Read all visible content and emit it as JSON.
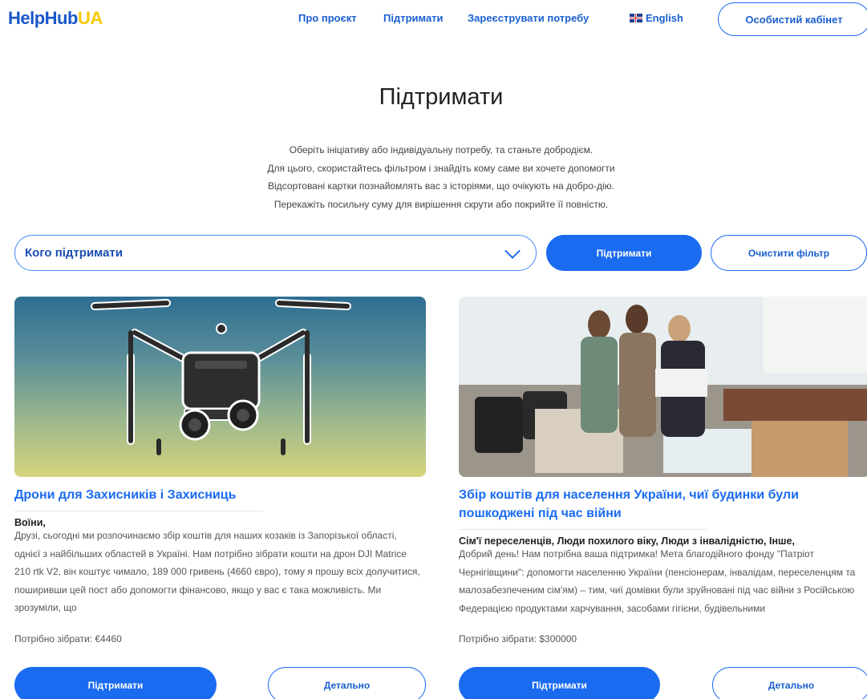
{
  "header": {
    "logo_part1": "HelpHub",
    "logo_part2": "UA",
    "nav": {
      "about": "Про проєкт",
      "support": "Підтримати",
      "register": "Зареєструвати потребу",
      "language": "English"
    },
    "cabinet_button": "Особистий кабінет"
  },
  "hero": {
    "title": "Підтримати",
    "intro_lines": [
      "Оберіть ініціативу або індивідуальну потребу, та станьте добродієм.",
      "Для цього, скористайтесь фільтром і знайдіть кому саме ви хочете допомогти",
      "Відсортовані картки познайомлять вас з історіями, що очікують на добро-дію.",
      "Перекажіть посильну суму для вирішення скрути або покрийте її повністю."
    ]
  },
  "filter": {
    "select_label": "Кого підтримати",
    "apply_button": "Підтримати",
    "clear_button": "Очистити фільтр"
  },
  "cards": [
    {
      "title": "Дрони для Захисників і Захисниць",
      "categories": "Воїни,",
      "description": "Друзі, сьогодні ми розпочинаємо збір коштів для наших козаків із Запорізької області, однієї з найбільших областей в Україні. Нам потрібно зібрати кошти на дрон DJI Matrice 210 rtk V2, він коштує чимало, 189 000 гривень (4660 євро), тому я прошу всіх долучитися, поширивши цей пост або допомогти фінансово, якщо у вас є така можливість. Ми зрозуміли, що",
      "goal": "Потрібно зібрати: €4460",
      "support_button": "Підтримати",
      "details_button": "Детально"
    },
    {
      "title": "Збір коштів для населення України, чиї будинки були пошкоджені під час війни",
      "categories": "Сім'ї переселенців, Люди похилого віку, Люди з інвалідністю, Інше,",
      "description": "Добрий день! Нам потрібна ваша підтримка! Мета благодійного фонду \"Патріот Чернігівщини\": допомогти населенню України (пенсіонерам, інвалідам, переселенцям та малозабезпеченим сім'ям) – тим, чиї домівки були зруйновані під час війни з Російською Федерацією продуктами харчування, засобами гігієни, будівельними",
      "goal": "Потрібно зібрати: $300000",
      "support_button": "Підтримати",
      "details_button": "Детально"
    }
  ],
  "colors": {
    "primary": "#1a6bf0",
    "logo_blue": "#1a56c9",
    "logo_yellow": "#f7c900"
  }
}
